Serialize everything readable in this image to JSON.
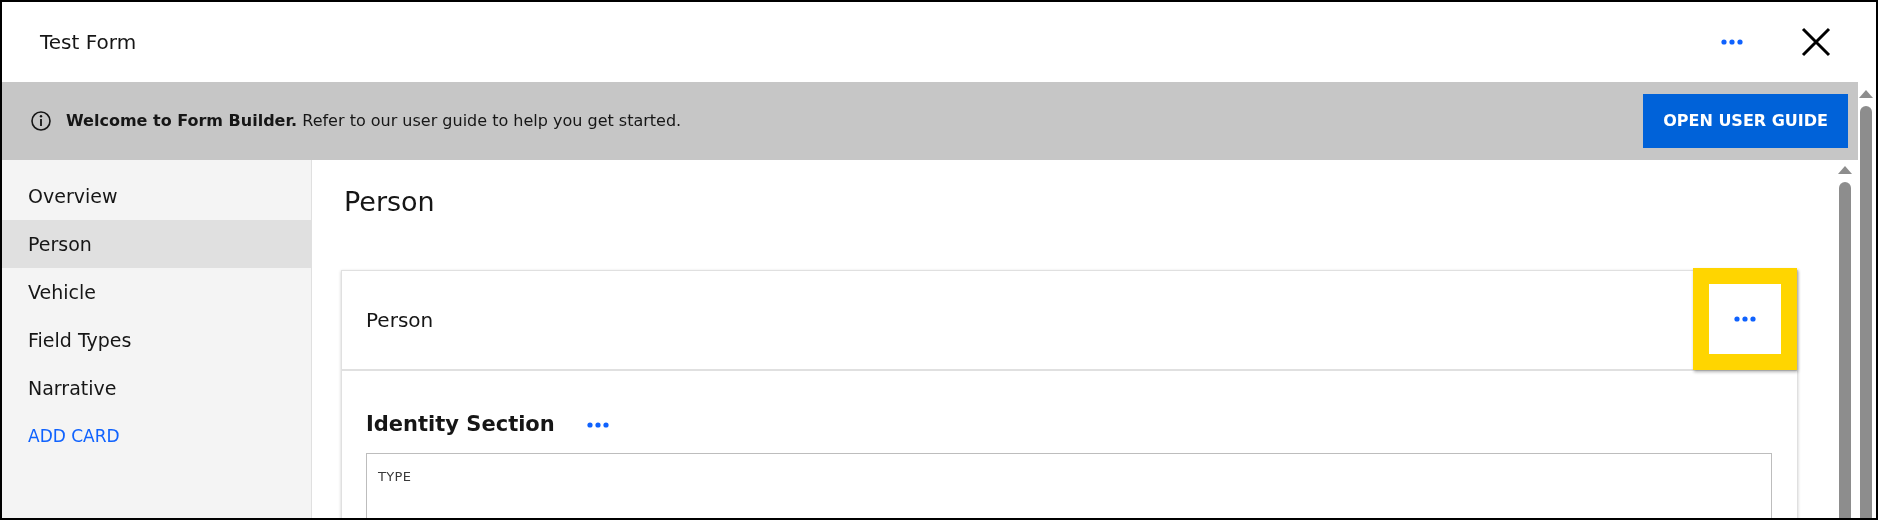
{
  "window": {
    "title": "Test Form"
  },
  "banner": {
    "text": "**Welcome to Form Builder.** Refer to our user guide to help you get started.",
    "button": "OPEN USER GUIDE"
  },
  "sidebar": {
    "items": [
      {
        "label": "Overview",
        "selected": false
      },
      {
        "label": "Person",
        "selected": true
      },
      {
        "label": "Vehicle",
        "selected": false
      },
      {
        "label": "Field Types",
        "selected": false
      },
      {
        "label": "Narrative",
        "selected": false
      }
    ],
    "add_link": "ADD CARD"
  },
  "page_title": "Person",
  "card": {
    "title": "Person",
    "menu_highlighted": true,
    "section": {
      "title": "Identity Section",
      "field": {
        "label": "TYPE"
      }
    }
  }
}
